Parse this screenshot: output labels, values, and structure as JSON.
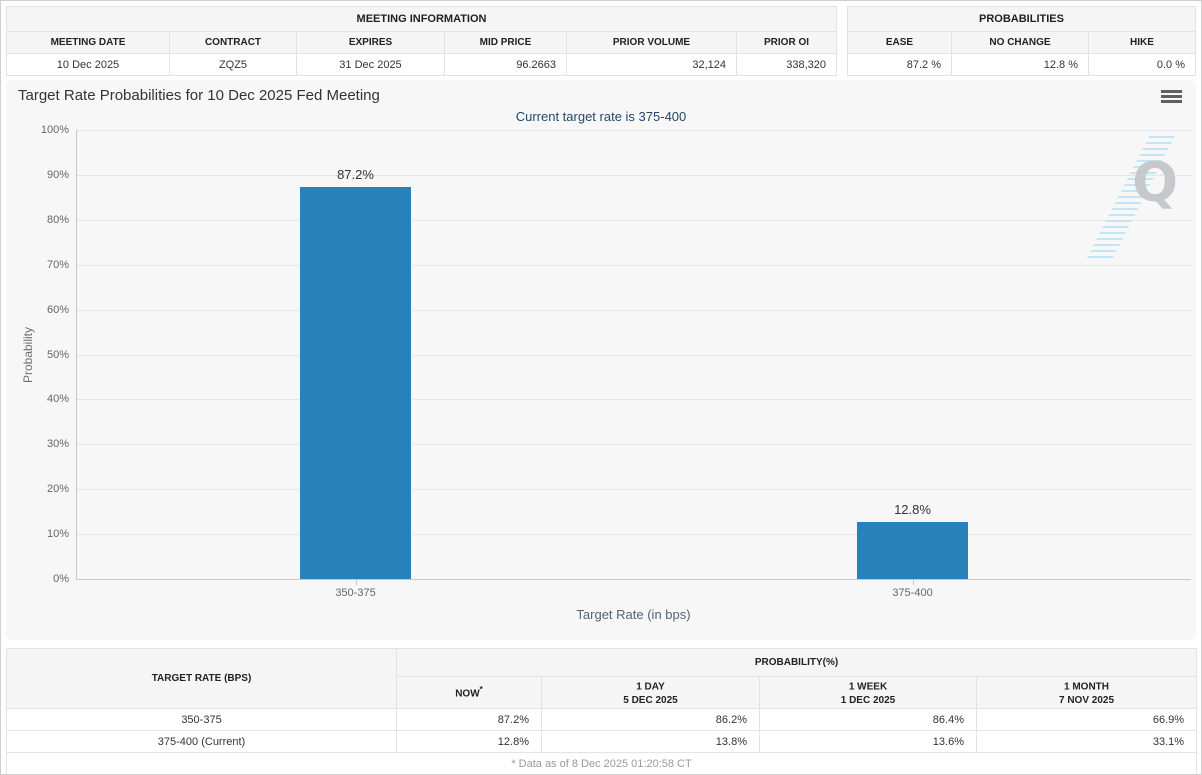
{
  "meeting_info": {
    "title": "MEETING INFORMATION",
    "columns": [
      "MEETING DATE",
      "CONTRACT",
      "EXPIRES",
      "MID PRICE",
      "PRIOR VOLUME",
      "PRIOR OI"
    ],
    "values": [
      "10 Dec 2025",
      "ZQZ5",
      "31 Dec 2025",
      "96.2663",
      "32,124",
      "338,320"
    ]
  },
  "probabilities_summary": {
    "title": "PROBABILITIES",
    "columns": [
      "EASE",
      "NO CHANGE",
      "HIKE"
    ],
    "values": [
      "87.2 %",
      "12.8 %",
      "0.0 %"
    ]
  },
  "chart": {
    "watermark_letter": "Q"
  },
  "chart_data": {
    "type": "bar",
    "title": "Target Rate Probabilities for 10 Dec 2025 Fed Meeting",
    "subtitle": "Current target rate is 375-400",
    "categories": [
      "350-375",
      "375-400"
    ],
    "values": [
      87.2,
      12.8
    ],
    "data_labels": [
      "87.2%",
      "12.8%"
    ],
    "xlabel": "Target Rate (in bps)",
    "ylabel": "Probability",
    "ylim": [
      0,
      100
    ],
    "ytick_step": 10,
    "ytick_suffix": "%",
    "grid": "dotted-horizontal",
    "legend": "none",
    "bar_color": "#2a80b9"
  },
  "history_table": {
    "col1_header": "TARGET RATE (BPS)",
    "group_header": "PROBABILITY(%)",
    "sub_headers": [
      {
        "label": "NOW",
        "sup": "*",
        "date": ""
      },
      {
        "label": "1 DAY",
        "sup": "",
        "date": "5 DEC 2025"
      },
      {
        "label": "1 WEEK",
        "sup": "",
        "date": "1 DEC 2025"
      },
      {
        "label": "1 MONTH",
        "sup": "",
        "date": "7 NOV 2025"
      }
    ],
    "rows": [
      {
        "label": "350-375",
        "now": "87.2%",
        "day": "86.2%",
        "week": "86.4%",
        "month": "66.9%"
      },
      {
        "label": "375-400 (Current)",
        "now": "12.8%",
        "day": "13.8%",
        "week": "13.6%",
        "month": "33.1%"
      }
    ],
    "footnote": "* Data as of 8 Dec 2025 01:20:58 CT"
  },
  "colors": {
    "bar": "#2a80b9",
    "now_highlight": "#fafad9",
    "header_bg": "#f5f5f5",
    "chart_bg": "#f7f7f7",
    "subtitle_text": "#26466b"
  }
}
